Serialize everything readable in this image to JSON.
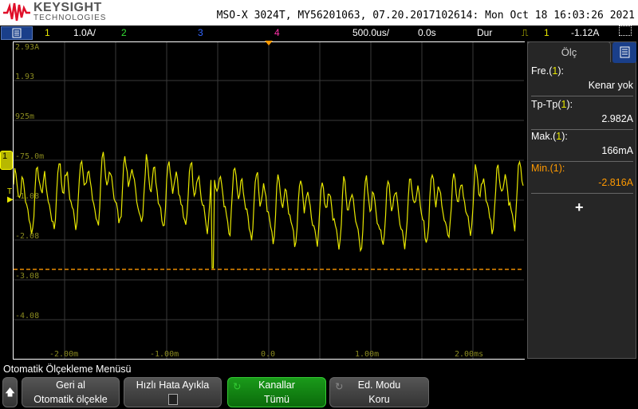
{
  "header": {
    "brand": "KEYSIGHT",
    "brand_sub": "TECHNOLOGIES",
    "title": "MSO-X 3024T, MY56201063, 07.20.2017102614: Mon Oct 18 16:03:26 2021"
  },
  "status": {
    "ch1": "1",
    "ch1_scale": "1.0A/",
    "ch2": "2",
    "ch3": "3",
    "ch4": "4",
    "timebase": "500.0us/",
    "delay": "0.0s",
    "mode": "Dur",
    "trig_src": "1",
    "trig_level": "-1.12A"
  },
  "colors": {
    "ch1": "#e8e800",
    "ch2": "#33dd33",
    "ch3": "#3366ff",
    "ch4": "#ff33aa",
    "trigger": "#ff9900"
  },
  "y_labels": [
    "2.93A",
    "1.93",
    "925m",
    "-75.0m",
    "-1.08",
    "-2.08",
    "-3.08",
    "-4.08"
  ],
  "x_labels": [
    "-2.00m",
    "-1.00m",
    "0.0",
    "1.00m",
    "2.00ms"
  ],
  "channel_marker": "1",
  "trigger_line_value_A": -2.816,
  "panel": {
    "tab": "Ölç",
    "measurements": [
      {
        "name": "Fre.(",
        "ch": "1",
        "close": "):",
        "value": "Kenar yok"
      },
      {
        "name": "Tp-Tp(",
        "ch": "1",
        "close": "):",
        "value": "2.982A"
      },
      {
        "name": "Mak.(",
        "ch": "1",
        "close": "):",
        "value": "166mA"
      },
      {
        "name": "Min.(",
        "ch": "1",
        "close": "):",
        "value": "-2.816A"
      }
    ],
    "add": "+"
  },
  "softkeys": {
    "menu_title": "Otomatik Ölçekleme Menüsü",
    "undo_l1": "Geri al",
    "undo_l2": "Otomatik ölçekle",
    "debug": "Hızlı Hata Ayıkla",
    "channels_l1": "Kanallar",
    "channels_l2": "Tümü",
    "mode_l1": "Ed. Modu",
    "mode_l2": "Koru"
  }
}
